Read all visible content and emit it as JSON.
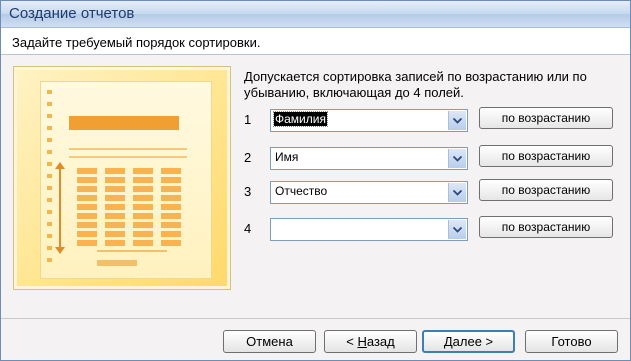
{
  "window": {
    "title": "Создание отчетов"
  },
  "header": {
    "subtitle": "Задайте требуемый порядок сортировки."
  },
  "main": {
    "description": "Допускается сортировка записей по возрастанию или по убыванию, включающая до 4 полей.",
    "sort_rows": [
      {
        "number": "1",
        "field": "Фамилия",
        "order": "по возрастанию"
      },
      {
        "number": "2",
        "field": "Имя",
        "order": "по возрастанию"
      },
      {
        "number": "3",
        "field": "Отчество",
        "order": "по возрастанию"
      },
      {
        "number": "4",
        "field": "",
        "order": "по возрастанию"
      }
    ]
  },
  "footer": {
    "cancel": "Отмена",
    "back_prefix": "< ",
    "back_hotkey": "Н",
    "back_rest": "азад",
    "next_hotkey": "Д",
    "next_rest": "алее >",
    "finish": "Готово"
  },
  "icons": {
    "dropdown": "chevron-down-icon"
  },
  "colors": {
    "titlebar": "#c6d8ef",
    "illustration": "#ffe58f",
    "accent": "#3c7fb1"
  }
}
